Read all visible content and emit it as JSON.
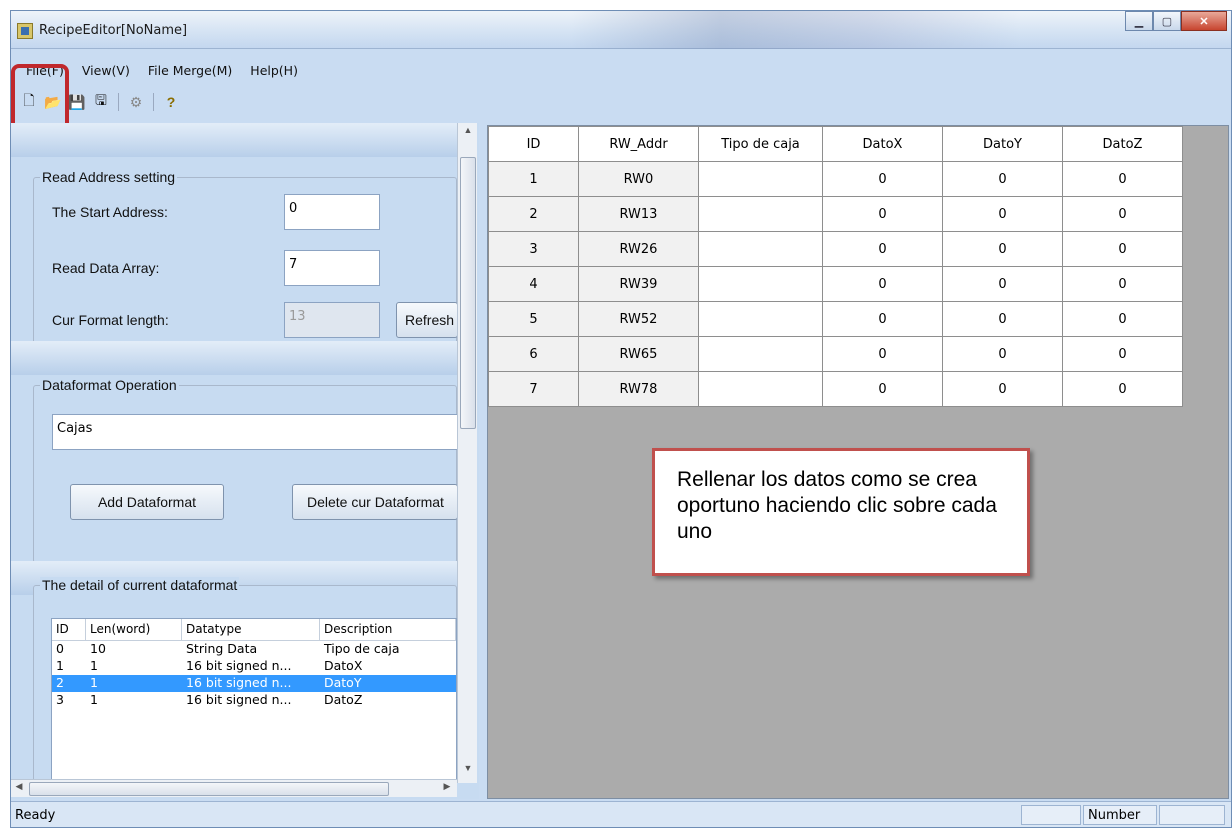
{
  "window": {
    "title": "RecipeEditor[NoName]"
  },
  "menu": [
    {
      "label": "File(F)"
    },
    {
      "label": "View(V)"
    },
    {
      "label": "File Merge(M)"
    },
    {
      "label": "Help(H)"
    }
  ],
  "toolbar": {
    "icons": [
      "new-file-icon",
      "open-folder-icon",
      "save-icon",
      "save-as-icon",
      "gear-icon",
      "help-icon"
    ],
    "new_glyph": "🗋",
    "open_glyph": "📂",
    "save_glyph": "💾",
    "saveas_glyph": "🖫",
    "gear_glyph": "⚙",
    "help_glyph": "?"
  },
  "read_address": {
    "title": "Read Address setting",
    "start_label": "The Start Address:",
    "start_value": "0",
    "array_label": "Read Data Array:",
    "array_value": "7",
    "format_label": "Cur Format length:",
    "format_value": "13",
    "refresh_label": "Refresh"
  },
  "dataformat_op": {
    "title": "Dataformat Operation",
    "current": "Cajas",
    "add_label": "Add Dataformat",
    "delete_label": "Delete cur Dataformat"
  },
  "detail": {
    "title": "The detail of current dataformat",
    "columns": [
      "ID",
      "Len(word)",
      "Datatype",
      "Description"
    ],
    "rows": [
      {
        "id": "0",
        "len": "10",
        "type": "String Data",
        "desc": "Tipo de caja"
      },
      {
        "id": "1",
        "len": "1",
        "type": "16 bit signed n...",
        "desc": "DatoX"
      },
      {
        "id": "2",
        "len": "1",
        "type": "16 bit signed n...",
        "desc": "DatoY"
      },
      {
        "id": "3",
        "len": "1",
        "type": "16 bit signed n...",
        "desc": "DatoZ"
      }
    ],
    "selected_row": 2
  },
  "grid": {
    "columns": [
      "ID",
      "RW_Addr",
      "Tipo de caja",
      "DatoX",
      "DatoY",
      "DatoZ"
    ],
    "rows": [
      [
        "1",
        "RW0",
        "",
        "0",
        "0",
        "0"
      ],
      [
        "2",
        "RW13",
        "",
        "0",
        "0",
        "0"
      ],
      [
        "3",
        "RW26",
        "",
        "0",
        "0",
        "0"
      ],
      [
        "4",
        "RW39",
        "",
        "0",
        "0",
        "0"
      ],
      [
        "5",
        "RW52",
        "",
        "0",
        "0",
        "0"
      ],
      [
        "6",
        "RW65",
        "",
        "0",
        "0",
        "0"
      ],
      [
        "7",
        "RW78",
        "",
        "0",
        "0",
        "0"
      ]
    ]
  },
  "callout": {
    "text": "Rellenar los datos como se crea oportuno haciendo clic sobre cada uno"
  },
  "status": {
    "text": "Ready",
    "mode": "Number"
  },
  "colors": {
    "highlight": "#c0282c",
    "callout_border": "#c0504d",
    "selection": "#3399ff"
  }
}
